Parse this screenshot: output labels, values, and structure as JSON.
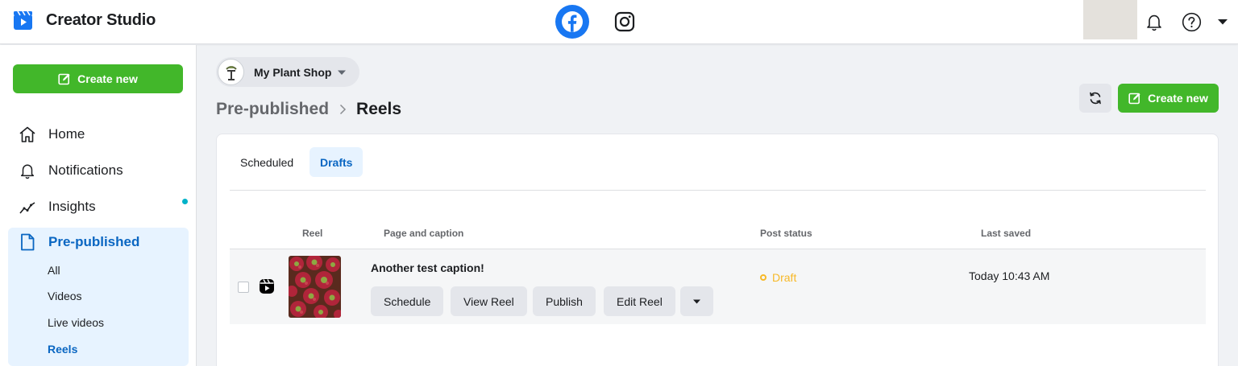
{
  "app": {
    "title": "Creator Studio",
    "brand_color": "#1877f2"
  },
  "topbar": {
    "platforms": [
      {
        "name": "facebook",
        "icon": "facebook-icon",
        "active": true
      },
      {
        "name": "instagram",
        "icon": "instagram-icon",
        "active": false
      }
    ],
    "icons": [
      "bell-icon",
      "help-icon",
      "caret-down-icon"
    ]
  },
  "sidebar": {
    "create_label": "Create new",
    "items": [
      {
        "label": "Home",
        "icon": "home-icon"
      },
      {
        "label": "Notifications",
        "icon": "bell-icon"
      },
      {
        "label": "Insights",
        "icon": "insights-icon",
        "has_dot": true
      },
      {
        "label": "Pre-published",
        "icon": "document-icon",
        "active": true
      }
    ],
    "sub_items": [
      {
        "label": "All"
      },
      {
        "label": "Videos"
      },
      {
        "label": "Live videos"
      },
      {
        "label": "Reels",
        "active": true
      }
    ]
  },
  "page_selector": {
    "name": "My Plant Shop"
  },
  "breadcrumb": {
    "parent": "Pre-published",
    "current": "Reels"
  },
  "main": {
    "create_label": "Create new",
    "tabs": [
      {
        "label": "Scheduled",
        "active": false
      },
      {
        "label": "Drafts",
        "active": true
      }
    ],
    "table": {
      "columns": [
        "Reel",
        "Page and caption",
        "Post status",
        "Last saved"
      ],
      "rows": [
        {
          "caption": "Another test caption!",
          "actions": [
            "Schedule",
            "View Reel",
            "Publish",
            "Edit Reel"
          ],
          "status": "Draft",
          "status_color": "#f7b928",
          "last_saved": "Today 10:43 AM"
        }
      ]
    }
  },
  "colors": {
    "accent_green": "#42b72a",
    "active_blue": "#0a66c2",
    "active_bg": "#e7f3ff"
  }
}
